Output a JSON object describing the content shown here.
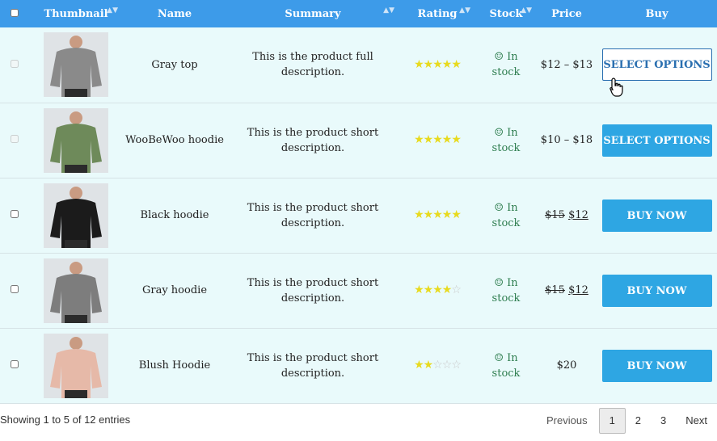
{
  "header": {
    "thumbnail": "Thumbnail",
    "name": "Name",
    "summary": "Summary",
    "rating": "Rating",
    "stock": "Stock",
    "price": "Price",
    "buy": "Buy",
    "sort_glyph": "▲▼"
  },
  "rows": [
    {
      "name": "Gray top",
      "summary": "This is the product full description.",
      "rating": 5,
      "stock": "☺ In stock",
      "price_text": "$12 – $13",
      "price_old": "",
      "price_new": "",
      "button": "SELECT OPTIONS",
      "color": "#8a8a8a"
    },
    {
      "name": "WooBeWoo hoodie",
      "summary": "This is the product short description.",
      "rating": 5,
      "stock": "☺ In stock",
      "price_text": "$10 – $18",
      "price_old": "",
      "price_new": "",
      "button": "SELECT OPTIONS",
      "color": "#6e8a5a"
    },
    {
      "name": "Black hoodie",
      "summary": "This is the product short description.",
      "rating": 5,
      "stock": "☺ In stock",
      "price_text": "",
      "price_old": "$15",
      "price_new": "$12",
      "button": "BUY NOW",
      "color": "#1b1b1b"
    },
    {
      "name": "Gray hoodie",
      "summary": "This is the product short description.",
      "rating": 4,
      "stock": "☺ In stock",
      "price_text": "",
      "price_old": "$15",
      "price_new": "$12",
      "button": "BUY NOW",
      "color": "#7d7d7d"
    },
    {
      "name": "Blush Hoodie",
      "summary": "This is the product short description.",
      "rating": 2,
      "stock": "☺ In stock",
      "price_text": "$20",
      "price_old": "",
      "price_new": "",
      "button": "BUY NOW",
      "color": "#e6b9a8"
    }
  ],
  "footer": {
    "info": "Showing 1 to 5 of 12 entries",
    "previous": "Previous",
    "pages": [
      "1",
      "2",
      "3"
    ],
    "next": "Next"
  }
}
